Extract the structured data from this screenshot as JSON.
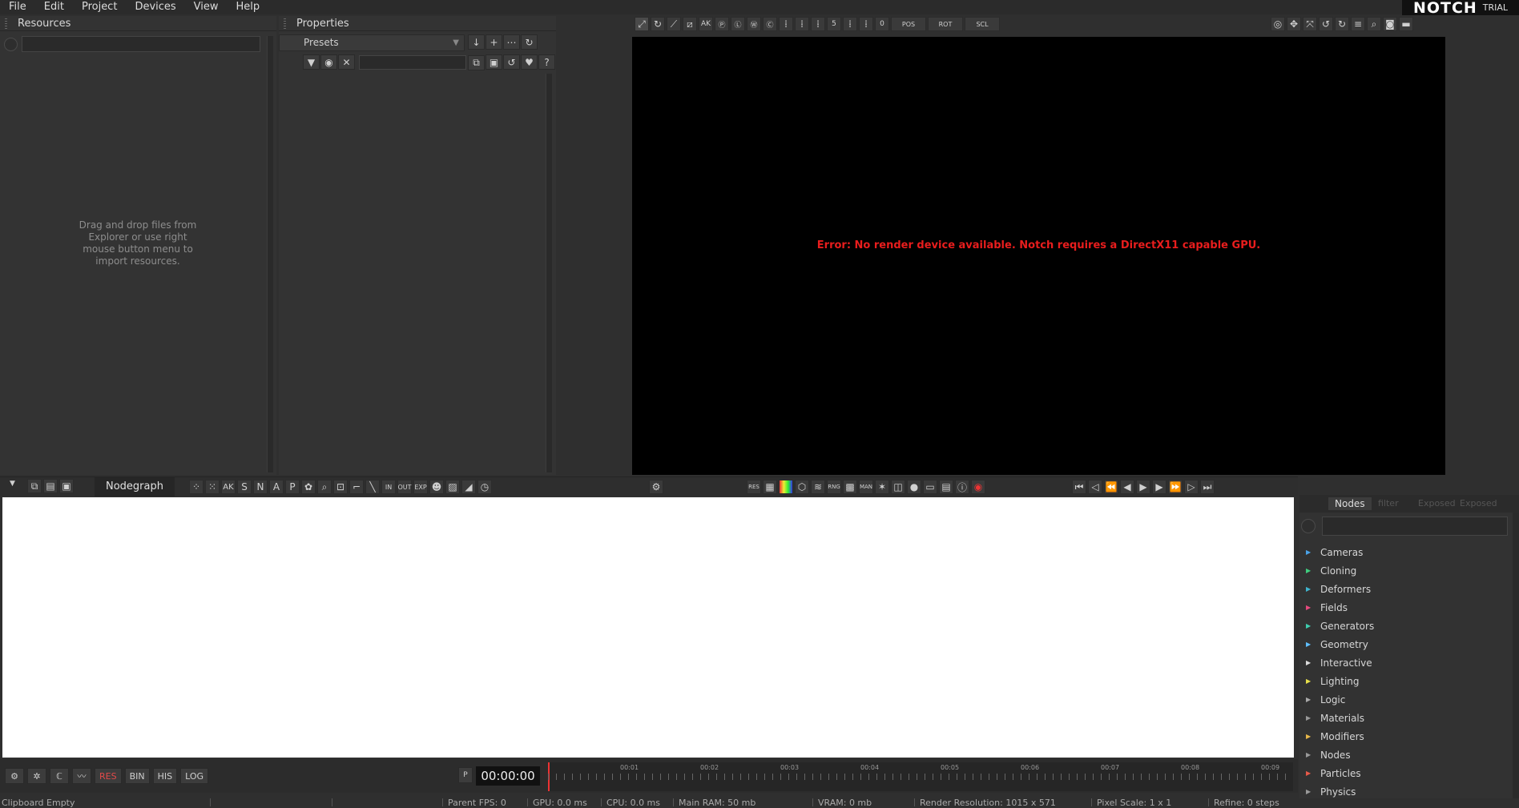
{
  "menu": {
    "file": "File",
    "edit": "Edit",
    "project": "Project",
    "devices": "Devices",
    "view": "View",
    "help": "Help"
  },
  "logo": {
    "brand": "NOTCH",
    "edition": "TRIAL"
  },
  "resources": {
    "title": "Resources",
    "search_placeholder": "",
    "hint": "Drag and drop files from Explorer or use right mouse button menu to import resources."
  },
  "properties": {
    "title": "Properties",
    "presets_label": "Presets",
    "filter_placeholder": ""
  },
  "viewport": {
    "error": "Error: No render device available. Notch requires a DirectX11 capable GPU.",
    "toolbar_labels": {
      "pos": "POS",
      "rot": "ROT",
      "scl": "SCL"
    }
  },
  "nodegraph": {
    "tab": "Nodegraph",
    "tool_letters": [
      "AK",
      "S",
      "N",
      "A",
      "P"
    ],
    "in_label": "IN",
    "out_label": "OUT",
    "exp_label": "EXP",
    "view_labels": {
      "res": "RES",
      "rng": "RNG",
      "man": "MAN"
    }
  },
  "nodes_panel": {
    "tabs": [
      "Nodes",
      "filter",
      "Exposed",
      "Exposed"
    ],
    "search_placeholder": "",
    "categories": [
      {
        "label": "Cameras",
        "color": "#4aa3e8"
      },
      {
        "label": "Cloning",
        "color": "#3fcf7f"
      },
      {
        "label": "Deformers",
        "color": "#3fb5cf"
      },
      {
        "label": "Fields",
        "color": "#e84a7f"
      },
      {
        "label": "Generators",
        "color": "#3fcfb0"
      },
      {
        "label": "Geometry",
        "color": "#5fbfff"
      },
      {
        "label": "Interactive",
        "color": "#dddddd"
      },
      {
        "label": "Lighting",
        "color": "#e8e04a"
      },
      {
        "label": "Logic",
        "color": "#aaaaaa"
      },
      {
        "label": "Materials",
        "color": "#9a9a9a"
      },
      {
        "label": "Modifiers",
        "color": "#e8b84a"
      },
      {
        "label": "Nodes",
        "color": "#9a9a9a"
      },
      {
        "label": "Particles",
        "color": "#e85a4a"
      },
      {
        "label": "Physics",
        "color": "#9a9a9a"
      }
    ]
  },
  "transport": {
    "time": "00:00:00",
    "p_label": "P",
    "markers": [
      "00:01",
      "00:02",
      "00:03",
      "00:04",
      "00:05",
      "00:06",
      "00:07",
      "00:08",
      "00:09"
    ]
  },
  "bottom_tools": {
    "res": "RES",
    "bin": "BIN",
    "his": "HIS",
    "log": "LOG"
  },
  "status": {
    "clipboard": "Clipboard Empty",
    "parent_fps": "Parent FPS: 0",
    "gpu": "GPU: 0.0 ms",
    "cpu": "CPU: 0.0 ms",
    "ram": "Main RAM: 50 mb",
    "vram": "VRAM: 0 mb",
    "render_res": "Render Resolution: 1015 x 571",
    "pixel_scale": "Pixel Scale: 1 x 1",
    "refine": "Refine: 0 steps"
  }
}
